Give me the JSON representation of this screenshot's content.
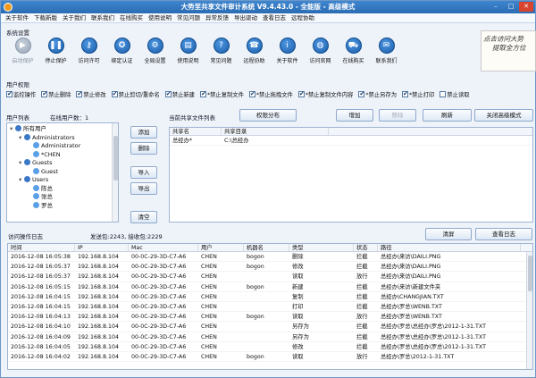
{
  "window": {
    "title": "大势至共享文件审计系统 V9.4.43.0 - 全能版 - 高级模式"
  },
  "menu": [
    "关于软件",
    "下载新版",
    "关于我们",
    "联系我们",
    "在线购买",
    "使用说明",
    "常见问题",
    "异常反馈",
    "导出驱动",
    "查看日志",
    "远程协助"
  ],
  "settings_group": "系统设置",
  "toolbar": [
    {
      "label": "启动保护",
      "icon": "play-icon",
      "glyph": "▶",
      "disabled": true
    },
    {
      "label": "停止保护",
      "icon": "pause-icon",
      "glyph": "❚❚",
      "disabled": false
    },
    {
      "label": "访问许可",
      "icon": "key-icon",
      "glyph": "⚷",
      "disabled": false
    },
    {
      "label": "绑定认证",
      "icon": "shield-icon",
      "glyph": "✪",
      "disabled": false
    },
    {
      "label": "全局设置",
      "icon": "gear-icon",
      "glyph": "⚙",
      "disabled": false
    },
    {
      "label": "使用说明",
      "icon": "book-icon",
      "glyph": "▤",
      "disabled": false
    },
    {
      "label": "常见问题",
      "icon": "help-icon",
      "glyph": "?",
      "disabled": false
    },
    {
      "label": "远程协助",
      "icon": "remote-icon",
      "glyph": "☎",
      "disabled": false
    },
    {
      "label": "关于软件",
      "icon": "info-icon",
      "glyph": "i",
      "disabled": false
    },
    {
      "label": "访问官网",
      "icon": "globe-icon",
      "glyph": "◍",
      "disabled": false
    },
    {
      "label": "在线购买",
      "icon": "cart-icon",
      "glyph": "⛟",
      "disabled": false
    },
    {
      "label": "联系我们",
      "icon": "contact-icon",
      "glyph": "✉",
      "disabled": false
    }
  ],
  "brand": {
    "line1": "点去访问大势",
    "line2": "提取全方位"
  },
  "perm_group": "用户权限",
  "permissions": [
    {
      "label": "监控操作",
      "checked": true
    },
    {
      "label": "禁止删除",
      "checked": true
    },
    {
      "label": "禁止修改",
      "checked": true
    },
    {
      "label": "禁止剪切/重命名",
      "checked": true
    },
    {
      "label": "禁止新建",
      "checked": true
    },
    {
      "label": "*禁止复制文件",
      "checked": true
    },
    {
      "label": "*禁止拖拽文件",
      "checked": true
    },
    {
      "label": "*禁止复制文件内容",
      "checked": true
    },
    {
      "label": "*禁止另存为",
      "checked": true
    },
    {
      "label": "*禁止打印",
      "checked": true
    },
    {
      "label": "禁止读取",
      "checked": false
    }
  ],
  "users": {
    "title": "用户列表",
    "online": "在线用户数：1",
    "tree": [
      {
        "text": "所有用户",
        "level": 0,
        "type": "group"
      },
      {
        "text": "Administrators",
        "level": 1,
        "type": "group"
      },
      {
        "text": "Administrator",
        "level": 2,
        "type": "user"
      },
      {
        "text": "*CHEN",
        "level": 2,
        "type": "user"
      },
      {
        "text": "Guests",
        "level": 1,
        "type": "group"
      },
      {
        "text": "Guest",
        "level": 2,
        "type": "user"
      },
      {
        "text": "Users",
        "level": 1,
        "type": "group"
      },
      {
        "text": "陈总",
        "level": 2,
        "type": "user"
      },
      {
        "text": "张总",
        "level": 2,
        "type": "user"
      },
      {
        "text": "罗总",
        "level": 2,
        "type": "user"
      }
    ]
  },
  "side_buttons": {
    "add": "添加",
    "delete": "删除",
    "import": "导入",
    "export": "导出",
    "clear": "清空"
  },
  "shares": {
    "title": "当前共享文件列表",
    "perm_button": "权限分布",
    "add_button": "增加",
    "remove_button": "移除",
    "refresh_button": "刷新",
    "close_advanced": "关闭高级模式",
    "columns": [
      "共享名",
      "共享目录"
    ],
    "rows": [
      [
        "总经办*",
        "C:\\总经办"
      ]
    ]
  },
  "log": {
    "title": "访问操作日志",
    "stats": "发送包:2243, 接收包:2229",
    "clear_button": "清屏",
    "view_button": "查看日志",
    "columns": [
      "时间",
      "IP",
      "Mac",
      "用户",
      "机器名",
      "类型",
      "状态",
      "路径"
    ],
    "rows": [
      [
        "2016-12-08 16:05:38",
        "192.168.8.104",
        "00-0C-29-3D-C7-A6",
        "CHEN",
        "bogon",
        "删除",
        "拦截",
        "总经办\\来访\\DAILI.PNG"
      ],
      [
        "2016-12-08 16:05:37",
        "192.168.8.104",
        "00-0C-29-3D-C7-A6",
        "CHEN",
        "bogon",
        "修改",
        "拦截",
        "总经办\\来访\\DAILI.PNG"
      ],
      [
        "2016-12-08 16:05:37",
        "192.168.8.104",
        "00-0C-29-3D-C7-A6",
        "CHEN",
        "",
        "读取",
        "放行",
        "总经办\\来访\\DAILI.PNG"
      ],
      [
        "2016-12-08 16:05:15",
        "192.168.8.104",
        "00-0C-29-3D-C7-A6",
        "CHEN",
        "bogon",
        "新建",
        "拦截",
        "总经办\\来访\\新建文件夹"
      ],
      [
        "2016-12-08 16:04:15",
        "192.168.8.104",
        "00-0C-29-3D-C7-A6",
        "CHEN",
        "",
        "复制",
        "拦截",
        "总经办\\CHANGJIAN.TXT"
      ],
      [
        "2016-12-08 16:04:15",
        "192.168.8.104",
        "00-0C-29-3D-C7-A6",
        "CHEN",
        "",
        "打印",
        "拦截",
        "总经办\\罗总\\WENB.TXT"
      ],
      [
        "2016-12-08 16:04:13",
        "192.168.8.104",
        "00-0C-29-3D-C7-A6",
        "CHEN",
        "bogon",
        "读取",
        "放行",
        "总经办\\罗总\\WENB.TXT"
      ],
      [
        "2016-12-08 16:04:10",
        "192.168.8.104",
        "00-0C-29-3D-C7-A6",
        "CHEN",
        "",
        "另存为",
        "拦截",
        "总经办\\罗总\\总经办\\罗总\\2012-1-31.TXT"
      ],
      [
        "2016-12-08 16:04:09",
        "192.168.8.104",
        "00-0C-29-3D-C7-A6",
        "CHEN",
        "",
        "另存为",
        "拦截",
        "总经办\\罗总\\总经办\\罗总\\2012-1-31.TXT"
      ],
      [
        "2016-12-08 16:04:05",
        "192.168.8.104",
        "00-0C-29-3D-C7-A6",
        "CHEN",
        "",
        "修改",
        "拦截",
        "总经办\\罗总\\总经办\\罗总\\2012-1-31.TXT"
      ],
      [
        "2016-12-08 16:04:02",
        "192.168.8.104",
        "00-0C-29-3D-C7-A6",
        "CHEN",
        "bogon",
        "读取",
        "放行",
        "总经办\\罗总\\2012-1-31.TXT"
      ]
    ]
  },
  "colors": {
    "titlebar": "#2a6cb3",
    "accent": "#1a5ea8",
    "panel_border": "#9fb5d2"
  }
}
